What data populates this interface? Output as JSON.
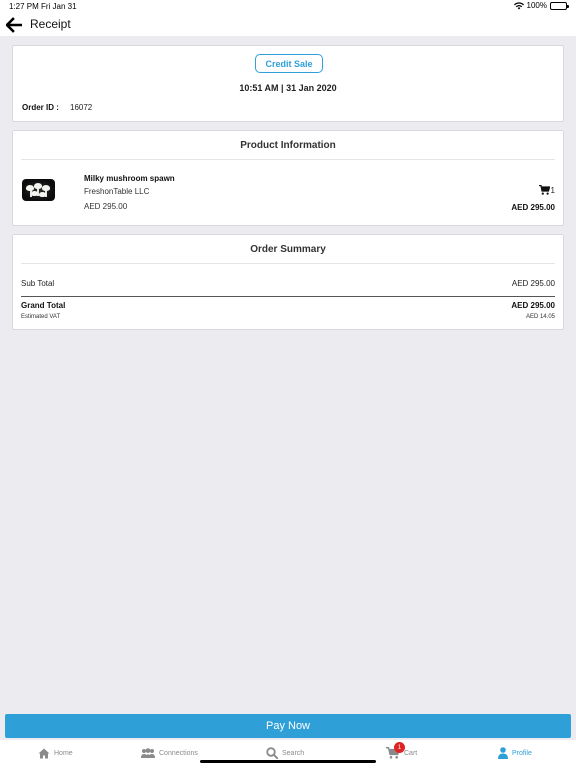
{
  "status_bar": {
    "time": "1:27 PM",
    "date": "Fri Jan 31",
    "battery": "100%"
  },
  "nav": {
    "title": "Receipt",
    "back_icon": "arrow-left-icon"
  },
  "order": {
    "credit_sale_label": "Credit Sale",
    "datetime": "10:51 AM | 31 Jan 2020",
    "id_label": "Order ID :",
    "id_value": "16072"
  },
  "product_info": {
    "title": "Product Information",
    "items": [
      {
        "name": "Milky mushroom spawn",
        "seller": "FreshonTable LLC",
        "price": "AED 295.00",
        "quantity": "1",
        "total": "AED 295.00"
      }
    ]
  },
  "order_summary": {
    "title": "Order Summary",
    "sub_total_label": "Sub Total",
    "sub_total_value": "AED 295.00",
    "grand_total_label": "Grand Total",
    "grand_total_value": "AED 295.00",
    "vat_label": "Estimated VAT",
    "vat_value": "AED 14.05"
  },
  "pay_button": {
    "label": "Pay Now"
  },
  "tabs": [
    {
      "label": "Home",
      "icon": "home-icon"
    },
    {
      "label": "Connections",
      "icon": "people-icon"
    },
    {
      "label": "Search",
      "icon": "search-icon"
    },
    {
      "label": "Cart",
      "icon": "cart-icon",
      "badge": "1"
    },
    {
      "label": "Profile",
      "icon": "user-icon",
      "active": true
    }
  ],
  "colors": {
    "accent": "#2f9fd8",
    "badge": "#e02424",
    "background": "#ebebf0"
  }
}
